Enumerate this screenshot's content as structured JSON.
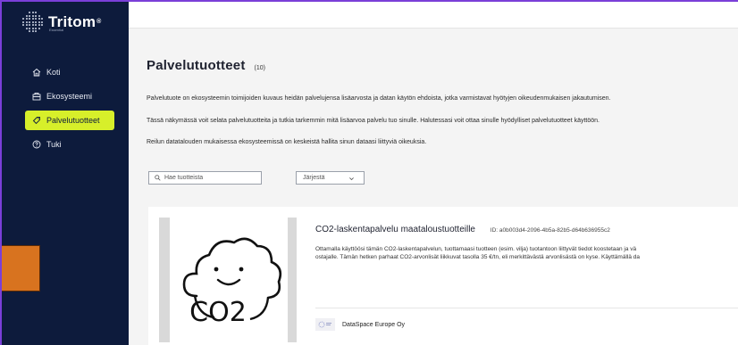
{
  "brand": {
    "name": "Tritom",
    "mark": "®",
    "sub": "Essential"
  },
  "nav": {
    "items": [
      {
        "label": "Koti",
        "icon": "home-icon"
      },
      {
        "label": "Ekosysteemi",
        "icon": "ecosystem-icon"
      },
      {
        "label": "Palvelutuotteet",
        "icon": "tag-icon",
        "active": true
      },
      {
        "label": "Tuki",
        "icon": "help-icon"
      }
    ]
  },
  "page": {
    "title": "Palvelutuotteet",
    "count": "(10)",
    "paragraphs": [
      "Palvelutuote on ekosysteemin toimijoiden kuvaus heidän palvelujensa lisäarvosta ja datan käytön ehdoista, jotka varmistavat hyötyjen oikeudenmukaisen jakautumisen.",
      "Tässä näkymässä voit selata palvelutuotteita ja tutkia tarkemmin mitä lisäarvoa palvelu tuo sinulle. Halutessasi voit ottaa sinulle hyödylliset palvelutuotteet käyttöön.",
      "Reilun datatalouden mukaisessa ekosysteemissä on keskeistä hallita sinun dataasi liittyviä oikeuksia."
    ]
  },
  "search": {
    "placeholder": "Hae tuotteista"
  },
  "sort": {
    "label": "Järjestä"
  },
  "card": {
    "title": "CO2-laskentapalvelu maataloustuotteille",
    "id": "ID: a0b003d4-2096-4b5a-82b5-d64b636955c2",
    "desc_line1": "Ottamalla käyttöösi tämän CO2-laskentapalvelun, tuottamaasi tuotteen (esim. vilja) tuotantoon liittyvät tiedot koostetaan ja vä",
    "desc_line2": "ostajalle. Tämän hetken parhaat CO2-arvonlisät liikkuvat tasolla 35 €/tn, eli merkittävästä arvonlisästä on kyse. Käyttämällä da",
    "image_text": "CO2",
    "provider": "DataSpace Europe Oy"
  },
  "colors": {
    "sidebar": "#0d1b3c",
    "accent": "#d7ef2a",
    "frame": "#7a3fd8",
    "tab": "#d8731f"
  }
}
